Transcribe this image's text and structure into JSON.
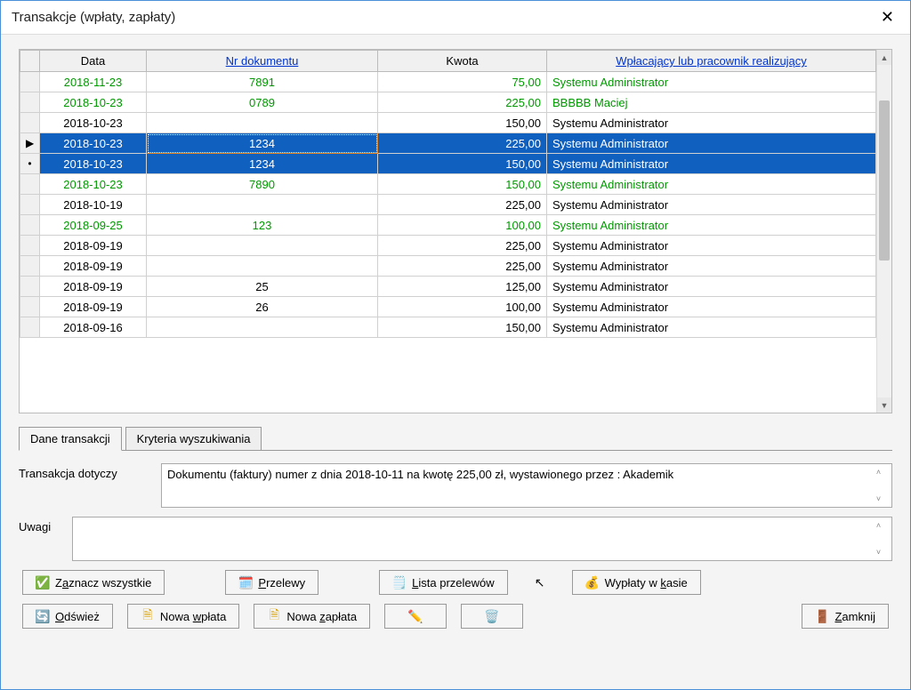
{
  "window": {
    "title": "Transakcje (wpłaty, zapłaty)"
  },
  "grid": {
    "headers": {
      "date": "Data",
      "doc": "Nr dokumentu",
      "amount": "Kwota",
      "payer": "Wpłacający lub pracownik realizujący"
    },
    "rows": [
      {
        "indicator": "",
        "date": "2018-11-23",
        "doc": "7891",
        "amount": "75,00",
        "payer": "Systemu Administrator",
        "style": "green"
      },
      {
        "indicator": "",
        "date": "2018-10-23",
        "doc": "0789",
        "amount": "225,00",
        "payer": "BBBBB Maciej",
        "style": "green"
      },
      {
        "indicator": "",
        "date": "2018-10-23",
        "doc": "",
        "amount": "150,00",
        "payer": "Systemu Administrator",
        "style": ""
      },
      {
        "indicator": "▶",
        "date": "2018-10-23",
        "doc": "1234",
        "amount": "225,00",
        "payer": "Systemu Administrator",
        "style": "sel sel-focus"
      },
      {
        "indicator": "•",
        "date": "2018-10-23",
        "doc": "1234",
        "amount": "150,00",
        "payer": "Systemu Administrator",
        "style": "sel"
      },
      {
        "indicator": "",
        "date": "2018-10-23",
        "doc": "7890",
        "amount": "150,00",
        "payer": "Systemu Administrator",
        "style": "green"
      },
      {
        "indicator": "",
        "date": "2018-10-19",
        "doc": "",
        "amount": "225,00",
        "payer": "Systemu Administrator",
        "style": ""
      },
      {
        "indicator": "",
        "date": "2018-09-25",
        "doc": "123",
        "amount": "100,00",
        "payer": "Systemu Administrator",
        "style": "green"
      },
      {
        "indicator": "",
        "date": "2018-09-19",
        "doc": "",
        "amount": "225,00",
        "payer": "Systemu Administrator",
        "style": ""
      },
      {
        "indicator": "",
        "date": "2018-09-19",
        "doc": "",
        "amount": "225,00",
        "payer": "Systemu Administrator",
        "style": ""
      },
      {
        "indicator": "",
        "date": "2018-09-19",
        "doc": "25",
        "amount": "125,00",
        "payer": "Systemu Administrator",
        "style": ""
      },
      {
        "indicator": "",
        "date": "2018-09-19",
        "doc": "26",
        "amount": "100,00",
        "payer": "Systemu Administrator",
        "style": ""
      },
      {
        "indicator": "",
        "date": "2018-09-16",
        "doc": "",
        "amount": "150,00",
        "payer": "Systemu Administrator",
        "style": ""
      }
    ]
  },
  "tabs": {
    "dane": "Dane transakcji",
    "kryteria": "Kryteria wyszukiwania"
  },
  "fields": {
    "dotyczy_label": "Transakcja dotyczy",
    "dotyczy_value": "Dokumentu (faktury) numer  z dnia 2018-10-11 na kwotę 225,00 zł, wystawionego przez  : Akademik",
    "uwagi_label": "Uwagi",
    "uwagi_value": ""
  },
  "buttons": {
    "zaznacz": {
      "label_pre": "Z",
      "label_u": "a",
      "label_post": "znacz wszystkie"
    },
    "przelewy": {
      "label_pre": "",
      "label_u": "P",
      "label_post": "rzelewy"
    },
    "lista": {
      "label_pre": "",
      "label_u": "L",
      "label_post": "ista przelewów"
    },
    "wyplaty": {
      "label_pre": "Wypłaty w ",
      "label_u": "k",
      "label_post": "asie"
    },
    "odswiez": {
      "label_pre": "",
      "label_u": "O",
      "label_post": "dśwież"
    },
    "nwplata": {
      "label_pre": "Nowa ",
      "label_u": "w",
      "label_post": "płata"
    },
    "nzaplata": {
      "label_pre": "Nowa ",
      "label_u": "z",
      "label_post": "apłata"
    },
    "zamknij": {
      "label_pre": "",
      "label_u": "Z",
      "label_post": "amknij"
    }
  }
}
